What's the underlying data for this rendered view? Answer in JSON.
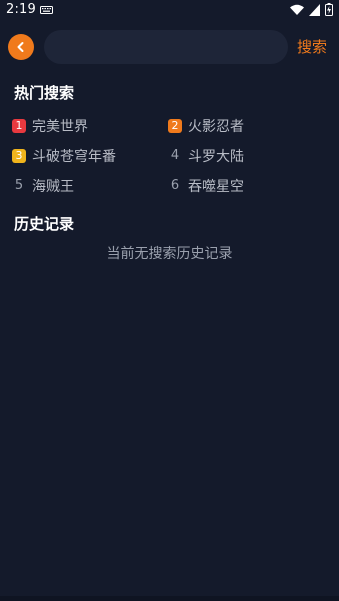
{
  "status_bar": {
    "time": "2:19",
    "icons": [
      "keyboard-icon",
      "wifi-icon",
      "signal-icon",
      "battery-icon"
    ]
  },
  "header": {
    "back_icon": "chevron-left-icon",
    "search_placeholder": "",
    "search_value": "",
    "search_button_label": "搜索"
  },
  "hot_search": {
    "title": "热门搜索",
    "items": [
      {
        "rank": "1",
        "label": "完美世界",
        "badge_color": "#e8393f"
      },
      {
        "rank": "2",
        "label": "火影忍者",
        "badge_color": "#f07a1c"
      },
      {
        "rank": "3",
        "label": "斗破苍穹年番",
        "badge_color": "#f0b41c"
      },
      {
        "rank": "4",
        "label": "斗罗大陆",
        "badge_color": ""
      },
      {
        "rank": "5",
        "label": "海贼王",
        "badge_color": ""
      },
      {
        "rank": "6",
        "label": "吞噬星空",
        "badge_color": ""
      }
    ]
  },
  "history": {
    "title": "历史记录",
    "empty_text": "当前无搜索历史记录"
  },
  "colors": {
    "background": "#141a2b",
    "accent": "#f07a1c",
    "input_bg": "#1e2538",
    "muted_text": "#9aa0ad"
  }
}
